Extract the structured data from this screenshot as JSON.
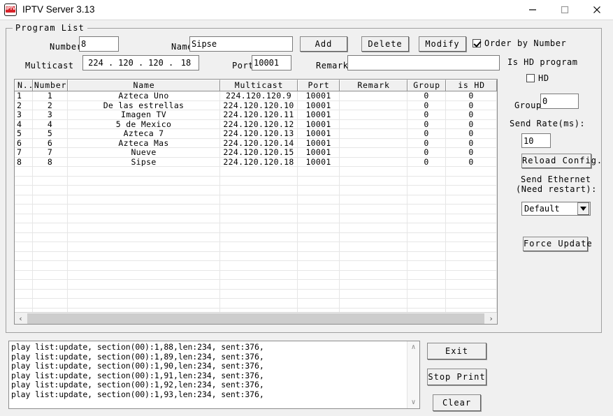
{
  "window": {
    "title": "IPTV Server 3.13",
    "icon": "iptv-logo-icon",
    "icon_text": "IPTV",
    "minimize_label": "—",
    "maximize_label": "□",
    "close_label": "✕"
  },
  "program_list": {
    "legend": "Program List",
    "fields": {
      "number_label": "Number",
      "number_value": "8",
      "name_label": "Name",
      "name_value": "Sipse",
      "multicast_label": "Multicast",
      "multicast_octets": [
        "224",
        "120",
        "120",
        "18"
      ],
      "multicast_dot": ".",
      "port_label": "Port",
      "port_value": "10001",
      "remark_label": "Remark",
      "remark_value": ""
    },
    "buttons": {
      "add": "Add",
      "delete": "Delete",
      "modify": "Modify"
    },
    "order_by_number": {
      "label": "Order by Number",
      "checked": true
    },
    "table": {
      "columns": [
        "N..",
        "Number",
        "Name",
        "Multicast",
        "Port",
        "Remark",
        "Group",
        "is HD"
      ],
      "rows": [
        [
          "1",
          "1",
          "Azteca Uno",
          "224.120.120.9",
          "10001",
          "",
          "0",
          "0"
        ],
        [
          "2",
          "2",
          "De las estrellas",
          "224.120.120.10",
          "10001",
          "",
          "0",
          "0"
        ],
        [
          "3",
          "3",
          "Imagen TV",
          "224.120.120.11",
          "10001",
          "",
          "0",
          "0"
        ],
        [
          "4",
          "4",
          "5 de Mexico",
          "224.120.120.12",
          "10001",
          "",
          "0",
          "0"
        ],
        [
          "5",
          "5",
          "Azteca 7",
          "224.120.120.13",
          "10001",
          "",
          "0",
          "0"
        ],
        [
          "6",
          "6",
          "Azteca Mas",
          "224.120.120.14",
          "10001",
          "",
          "0",
          "0"
        ],
        [
          "7",
          "7",
          "Nueve",
          "224.120.120.15",
          "10001",
          "",
          "0",
          "0"
        ],
        [
          "8",
          "8",
          "Sipse",
          "224.120.120.18",
          "10001",
          "",
          "0",
          "0"
        ]
      ],
      "scroll_left_icon": "‹",
      "scroll_right_icon": "›"
    },
    "side_panel": {
      "is_hd_program_label": "Is HD program",
      "hd_checkbox_label": "HD",
      "hd_checked": false,
      "group_label": "Group",
      "group_value": "0",
      "send_rate_label": "Send Rate(ms):",
      "send_rate_value": "10",
      "reload_config_button": "Reload Config.",
      "send_ethernet_label_line1": "Send Ethernet",
      "send_ethernet_label_line2": "(Need restart):",
      "ethernet_selected": "Default",
      "force_update_button": "Force Update"
    }
  },
  "log": {
    "text": "play list:update, section(00):1,88,len:234, sent:376,\nplay list:update, section(00):1,89,len:234, sent:376,\nplay list:update, section(00):1,90,len:234, sent:376,\nplay list:update, section(00):1,91,len:234, sent:376,\nplay list:update, section(00):1,92,len:234, sent:376,\nplay list:update, section(00):1,93,len:234, sent:376,",
    "scroll_up_icon": "∧",
    "scroll_down_icon": "∨"
  },
  "bottom_buttons": {
    "exit": "Exit",
    "stop_print": "Stop Print",
    "clear": "Clear"
  },
  "colors": {
    "window_bg": "#f0f0f0",
    "titlebar_bg": "#ffffff",
    "field_bg": "#ffffff",
    "border": "#8d8d8d",
    "accent_red": "#d8232a"
  }
}
